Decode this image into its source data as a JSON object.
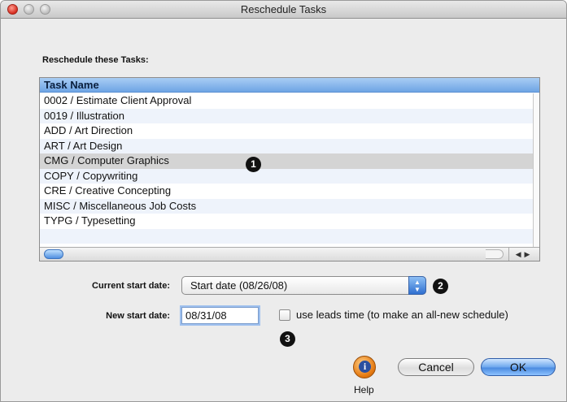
{
  "window": {
    "title": "Reschedule Tasks"
  },
  "section_label": "Reschedule these Tasks:",
  "task_table": {
    "header": "Task Name",
    "rows": [
      "0002 / Estimate Client Approval",
      "0019 / Illustration",
      "ADD / Art Direction",
      "ART / Art Design",
      "CMG / Computer Graphics",
      "COPY / Copywriting",
      "CRE / Creative Concepting",
      "MISC / Miscellaneous Job Costs",
      "TYPG / Typesetting"
    ],
    "selected_index": 4
  },
  "callouts": {
    "one": "1",
    "two": "2",
    "three": "3"
  },
  "form": {
    "current_start_label": "Current start date:",
    "current_start_value": "Start date (08/26/08)",
    "new_start_label": "New start date:",
    "new_start_value": "08/31/08",
    "leads_time_label": "use leads time (to make an all-new schedule)",
    "leads_time_checked": false
  },
  "buttons": {
    "help_label": "Help",
    "cancel": "Cancel",
    "ok": "OK"
  },
  "colors": {
    "header_blue": "#6ea4e4",
    "selection_gray": "#d4d4d4",
    "help_orange": "#e57a12"
  }
}
